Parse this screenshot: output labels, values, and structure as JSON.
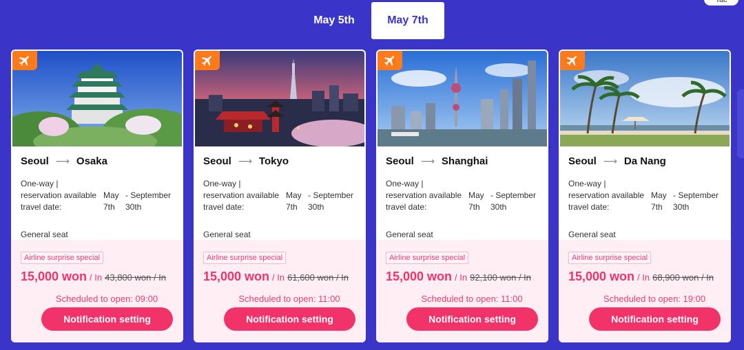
{
  "tabs": [
    {
      "label": "May 5th",
      "active": false
    },
    {
      "label": "May 7th",
      "active": true
    }
  ],
  "corner_badge": "Tac",
  "colors": {
    "background": "#3a34c9",
    "accent_pink": "#f2336a",
    "plane_badge": "#ff7a1a"
  },
  "cards": [
    {
      "image": "osaka-castle-photo",
      "from": "Seoul",
      "to": "Osaka",
      "trip_type": "One-way |",
      "reservation_label": "reservation available travel date:",
      "reservation_start": "May 7th",
      "reservation_end": "- September 30th",
      "seat": "General seat",
      "special": "Airline surprise special",
      "price": "15,000 won",
      "per": "/ In",
      "original_price": "43,800 won / In",
      "schedule": "Scheduled to open: 09:00",
      "button": "Notification setting"
    },
    {
      "image": "tokyo-skyline-photo",
      "from": "Seoul",
      "to": "Tokyo",
      "trip_type": "One-way |",
      "reservation_label": "reservation available travel date:",
      "reservation_start": "May 7th",
      "reservation_end": "- September 30th",
      "seat": "General seat",
      "special": "Airline surprise special",
      "price": "15,000 won",
      "per": "/ In",
      "original_price": "61,600 won / In",
      "schedule": "Scheduled to open: 11:00",
      "button": "Notification setting"
    },
    {
      "image": "shanghai-skyline-photo",
      "from": "Seoul",
      "to": "Shanghai",
      "trip_type": "One-way |",
      "reservation_label": "reservation available travel date:",
      "reservation_start": "May 7th",
      "reservation_end": "- September 30th",
      "seat": "General seat",
      "special": "Airline surprise special",
      "price": "15,000 won",
      "per": "/ In",
      "original_price": "92,100 won / In",
      "schedule": "Scheduled to open: 11:00",
      "button": "Notification setting"
    },
    {
      "image": "da-nang-beach-photo",
      "from": "Seoul",
      "to": "Da Nang",
      "trip_type": "One-way |",
      "reservation_label": "reservation available travel date:",
      "reservation_start": "May 7th",
      "reservation_end": "- September 30th",
      "seat": "General seat",
      "special": "Airline surprise special",
      "price": "15,000 won",
      "per": "/ In",
      "original_price": "68,900 won / In",
      "schedule": "Scheduled to open: 19:00",
      "button": "Notification setting"
    }
  ]
}
